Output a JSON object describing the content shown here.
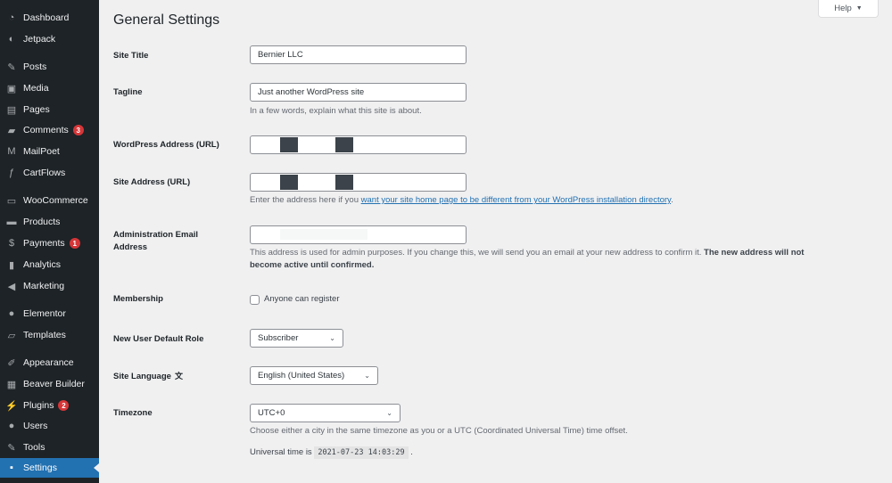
{
  "sidebar": {
    "items": [
      {
        "label": "Dashboard",
        "icon": "dashboard-icon",
        "glyph": "◔"
      },
      {
        "label": "Jetpack",
        "icon": "jetpack-icon",
        "glyph": "◐"
      },
      {
        "label": "Posts",
        "icon": "pushpin-icon",
        "glyph": "✎"
      },
      {
        "label": "Media",
        "icon": "media-icon",
        "glyph": "▣"
      },
      {
        "label": "Pages",
        "icon": "pages-icon",
        "glyph": "▤"
      },
      {
        "label": "Comments",
        "icon": "comments-icon",
        "glyph": "▰",
        "badge": "3"
      },
      {
        "label": "MailPoet",
        "icon": "mailpoet-icon",
        "glyph": "M"
      },
      {
        "label": "CartFlows",
        "icon": "cartflows-icon",
        "glyph": "ƒ"
      },
      {
        "label": "WooCommerce",
        "icon": "woocommerce-icon",
        "glyph": "▭"
      },
      {
        "label": "Products",
        "icon": "products-icon",
        "glyph": "▬"
      },
      {
        "label": "Payments",
        "icon": "payments-icon",
        "glyph": "$",
        "badge": "1"
      },
      {
        "label": "Analytics",
        "icon": "analytics-icon",
        "glyph": "▮"
      },
      {
        "label": "Marketing",
        "icon": "megaphone-icon",
        "glyph": "◀"
      },
      {
        "label": "Elementor",
        "icon": "elementor-icon",
        "glyph": "●"
      },
      {
        "label": "Templates",
        "icon": "folder-icon",
        "glyph": "▱"
      },
      {
        "label": "Appearance",
        "icon": "paintbrush-icon",
        "glyph": "✐"
      },
      {
        "label": "Beaver Builder",
        "icon": "beaver-builder-icon",
        "glyph": "▦"
      },
      {
        "label": "Plugins",
        "icon": "plugin-icon",
        "glyph": "⚡",
        "badge": "2"
      },
      {
        "label": "Users",
        "icon": "users-icon",
        "glyph": "●"
      },
      {
        "label": "Tools",
        "icon": "wrench-icon",
        "glyph": "✎"
      },
      {
        "label": "Settings",
        "icon": "settings-icon",
        "glyph": "▪",
        "active": true
      }
    ]
  },
  "header": {
    "title": "General Settings",
    "help_label": "Help",
    "help_arrow": "▼"
  },
  "form": {
    "site_title": {
      "label": "Site Title",
      "value": "Bernier LLC"
    },
    "tagline": {
      "label": "Tagline",
      "value": "Just another WordPress site",
      "description": "In a few words, explain what this site is about."
    },
    "wp_address": {
      "label": "WordPress Address (URL)",
      "value": ""
    },
    "site_address": {
      "label": "Site Address (URL)",
      "value": "",
      "description_prefix": "Enter the address here if you ",
      "description_link": "want your site home page to be different from your WordPress installation directory",
      "description_suffix": "."
    },
    "admin_email": {
      "label_line1": "Administration Email",
      "label_line2": "Address",
      "value": "",
      "description": "This address is used for admin purposes. If you change this, we will send you an email at your new address to confirm it. ",
      "description_bold_1": "The new address will not",
      "description_bold_2": "become active until confirmed."
    },
    "membership": {
      "label": "Membership",
      "checkbox_label": "Anyone can register",
      "checked": false
    },
    "default_role": {
      "label": "New User Default Role",
      "value": "Subscriber"
    },
    "site_language": {
      "label": "Site Language",
      "value": "English (United States)",
      "icon_glyph": "文"
    },
    "timezone": {
      "label": "Timezone",
      "value": "UTC+0",
      "description": "Choose either a city in the same timezone as you or a UTC (Coordinated Universal Time) time offset.",
      "universal_prefix": "Universal time is",
      "universal_time": "2021-07-23 14:03:29",
      "universal_suffix": "."
    }
  },
  "chevron": "⌄"
}
